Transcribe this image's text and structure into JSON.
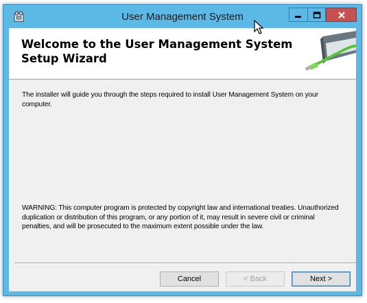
{
  "window": {
    "title": "User Management System",
    "controls": {
      "minimize_icon": "minimize-icon",
      "maximize_icon": "maximize-icon",
      "close_icon": "close-icon"
    }
  },
  "banner": {
    "title": "Welcome to the User Management System Setup Wizard",
    "art_icon": "disc-cable-icon"
  },
  "body": {
    "intro": "The installer will guide you through the steps required to install User Management System on your computer.",
    "warning": "WARNING: This computer program is protected by copyright law and international treaties. Unauthorized duplication or distribution of this program, or any portion of it, may result in severe civil or criminal penalties, and will be prosecuted to the maximum extent possible under the law."
  },
  "buttons": {
    "cancel": "Cancel",
    "back": "< Back",
    "next": "Next >"
  },
  "colors": {
    "frame": "#5cb8e4",
    "close_button": "#c75050",
    "client_bg": "#f0f0f0"
  }
}
